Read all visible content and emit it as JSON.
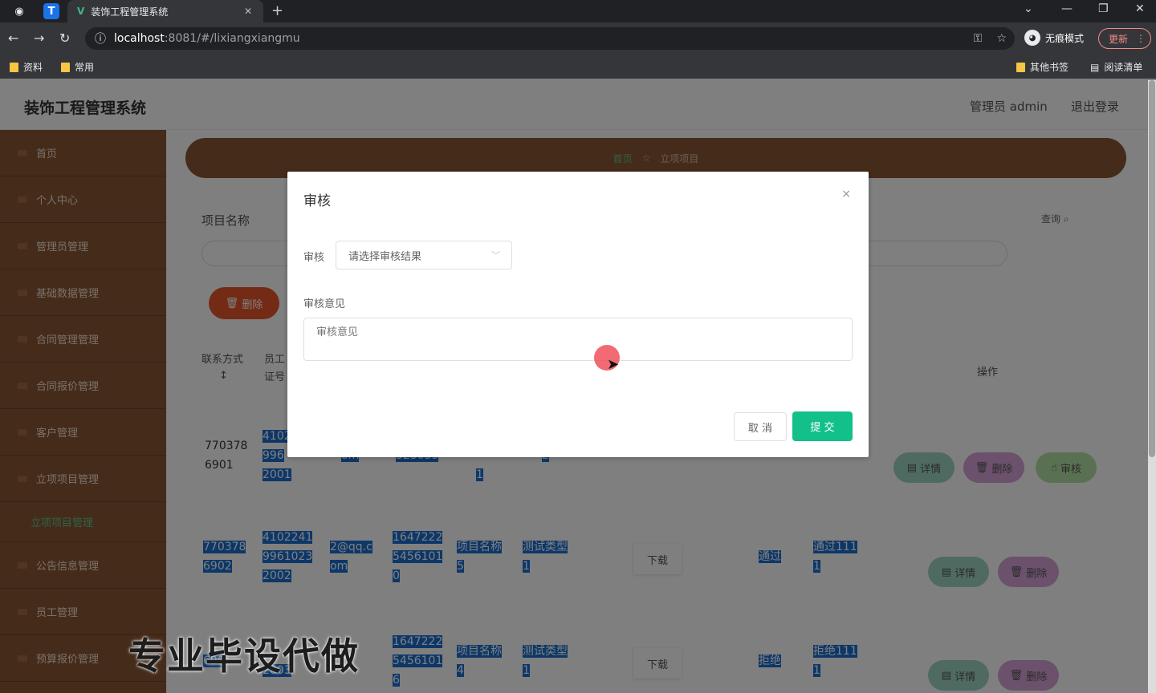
{
  "browser": {
    "tab_title": "装饰工程管理系统",
    "tab_close": "✕",
    "new_tab": "+",
    "url_host": "localhost",
    "url_path": ":8081/#/lixiangxiangmu",
    "incognito_label": "无痕模式",
    "update_label": "更新",
    "bookmarks": [
      "资料",
      "常用"
    ],
    "other_bookmarks": "其他书签",
    "reading_list": "阅读清单"
  },
  "header": {
    "title": "装饰工程管理系统",
    "user": "管理员 admin",
    "logout": "退出登录"
  },
  "sidebar": {
    "items": [
      "首页",
      "个人中心",
      "管理员管理",
      "基础数据管理",
      "合同管理管理",
      "合同报价管理",
      "客户管理",
      "立项项目管理"
    ],
    "sub_item": "立项项目管理",
    "items_after": [
      "公告信息管理",
      "员工管理",
      "预算报价管理"
    ]
  },
  "breadcrumb": {
    "home": "首页",
    "current": "立项项目"
  },
  "search": {
    "label": "项目名称",
    "button": "查询"
  },
  "toolbar": {
    "batch_delete": "删除"
  },
  "table": {
    "headers": [
      "联系方式",
      "员工",
      "证号",
      "操作"
    ],
    "rows": [
      {
        "phone_a": "770378",
        "phone_b": "6901",
        "id_a": "4102",
        "id_b": "996",
        "id_c": "2001",
        "email": "om",
        "num": "323059",
        "name_tail": "1",
        "type_tail": "2"
      },
      {
        "phone_a": "770378",
        "phone_b": "6902",
        "id_a": "4102241",
        "id_b": "9961023",
        "id_c": "2002",
        "email_a": "2@qq.c",
        "email_b": "om",
        "num_a": "1647222",
        "num_b": "5456101",
        "num_c": "0",
        "name_a": "项目名称",
        "name_b": "5",
        "type_a": "测试类型",
        "type_b": "1",
        "download": "下载",
        "status": "通过",
        "opinion_a": "通过111",
        "opinion_b": "1"
      },
      {
        "phone_b": "690",
        "id_c": "2003",
        "num_a": "1647222",
        "num_b": "5456101",
        "num_c": "6",
        "name_a": "项目名称",
        "name_b": "4",
        "type_a": "测试类型",
        "type_b": "1",
        "download": "下载",
        "status": "拒绝",
        "opinion_a": "拒绝111",
        "opinion_b": "1"
      }
    ],
    "btn_detail": "详情",
    "btn_delete": "删除",
    "btn_audit": "审核"
  },
  "dialog": {
    "title": "审核",
    "close": "×",
    "audit_label": "审核",
    "audit_placeholder": "请选择审核结果",
    "opinion_label": "审核意见",
    "opinion_placeholder": "审核意见",
    "cancel": "取 消",
    "submit": "提 交"
  },
  "watermark": "专业毕设代做",
  "colors": {
    "sidebar": "#8a5634",
    "accent": "#13c08a",
    "danger": "#e8572b"
  }
}
